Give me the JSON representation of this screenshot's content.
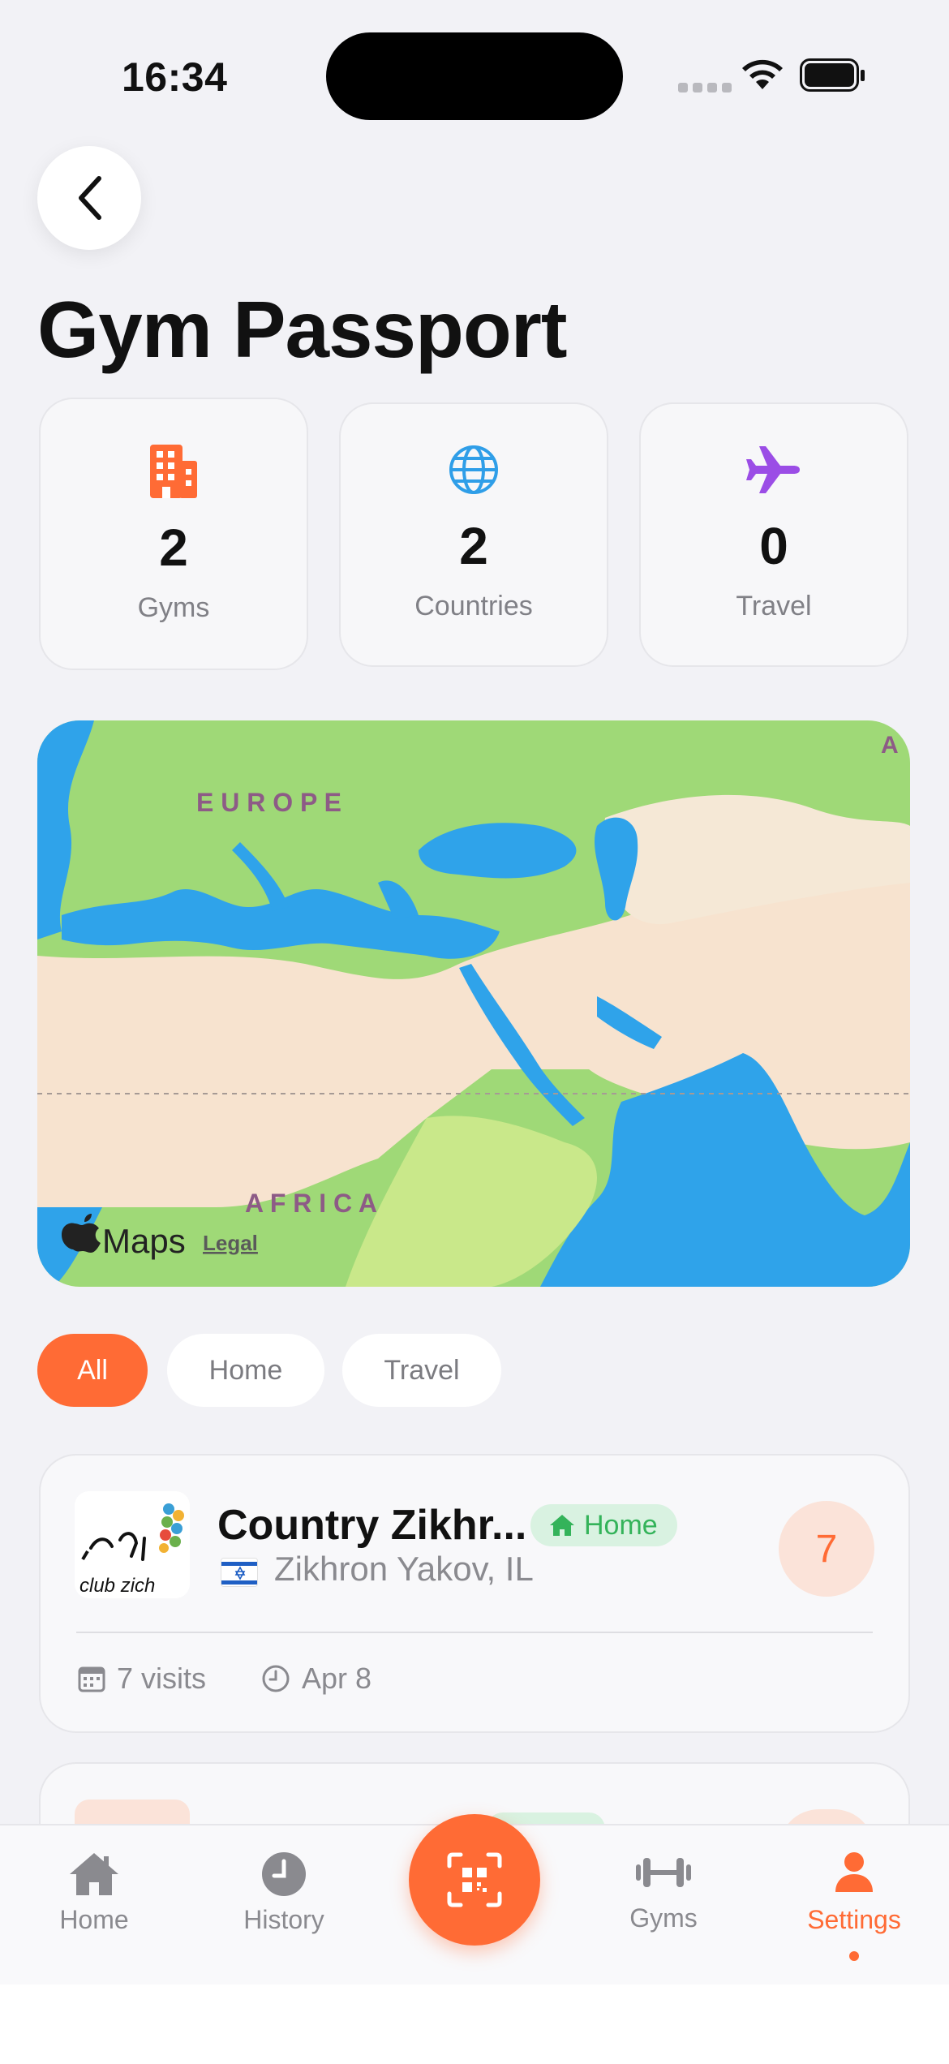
{
  "status_bar": {
    "time": "16:34"
  },
  "page": {
    "title": "Gym Passport"
  },
  "stats": [
    {
      "value": "2",
      "label": "Gyms",
      "icon": "building-icon",
      "color": "#ff6b35"
    },
    {
      "value": "2",
      "label": "Countries",
      "icon": "globe-icon",
      "color": "#2f9ee8"
    },
    {
      "value": "0",
      "label": "Travel",
      "icon": "airplane-icon",
      "color": "#9b4de6"
    }
  ],
  "map": {
    "labels": {
      "europe": "E U R O P E",
      "africa": "A F R I C A",
      "corner": "A"
    },
    "attribution": "Maps",
    "legal": "Legal"
  },
  "filters": {
    "items": [
      "All",
      "Home",
      "Travel"
    ],
    "selected": "All"
  },
  "gyms": [
    {
      "name": "Country Zikhr...",
      "badge": "Home",
      "location": "Zikhron Yakov, IL",
      "visit_count": "7",
      "visits_label": "7 visits",
      "last_visit": "Apr 8",
      "logo_text": "club zich"
    }
  ],
  "tabbar": {
    "home": "Home",
    "history": "History",
    "gyms": "Gyms",
    "settings": "Settings",
    "active": "Settings",
    "accent": "#ff6b35",
    "inactive_color": "#8a8a8f"
  }
}
